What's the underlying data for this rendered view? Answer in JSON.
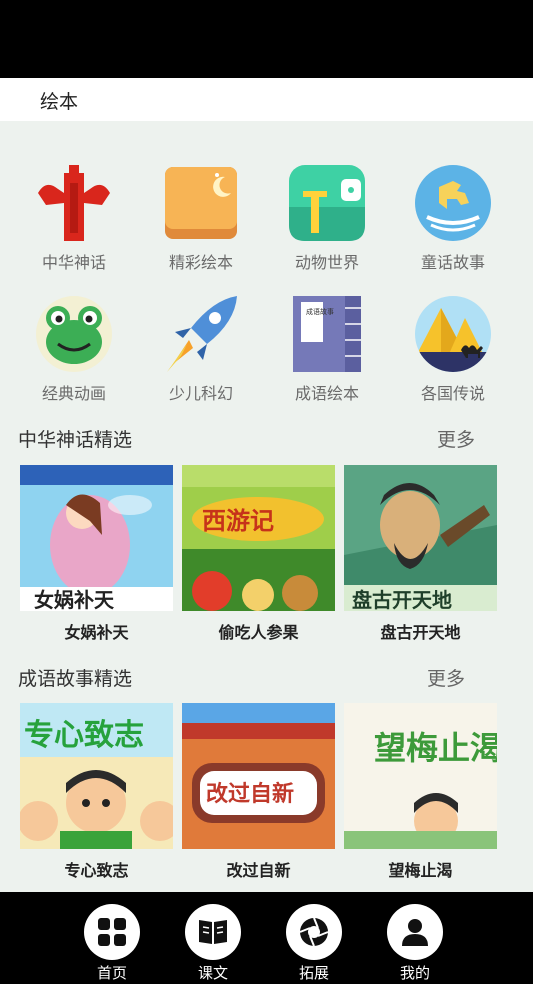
{
  "header": {
    "title": "绘本"
  },
  "categories": [
    {
      "label": "中华神话",
      "icon": "pillar-icon"
    },
    {
      "label": "精彩绘本",
      "icon": "bread-book-icon"
    },
    {
      "label": "动物世界",
      "icon": "giraffe-icon"
    },
    {
      "label": "童话故事",
      "icon": "rocking-horse-icon"
    },
    {
      "label": "经典动画",
      "icon": "frog-icon"
    },
    {
      "label": "少儿科幻",
      "icon": "rocket-icon"
    },
    {
      "label": "成语绘本",
      "icon": "idiom-book-icon"
    },
    {
      "label": "各国传说",
      "icon": "pyramid-camel-icon"
    }
  ],
  "icon_text": {
    "idiom_book": "成语故事"
  },
  "sections": [
    {
      "title": "中华神话精选",
      "more": "更多",
      "books": [
        {
          "title": "女娲补天",
          "cover_text": "女娲补天"
        },
        {
          "title": "偷吃人参果",
          "cover_text": "西游记"
        },
        {
          "title": "盘古开天地",
          "cover_text": "盘古开天地"
        }
      ]
    },
    {
      "title": "成语故事精选",
      "more": "更多",
      "books": [
        {
          "title": "专心致志",
          "cover_text": "专心致志"
        },
        {
          "title": "改过自新",
          "cover_text": "改过自新"
        },
        {
          "title": "望梅止渴",
          "cover_text": "望梅止渴"
        }
      ]
    }
  ],
  "nav": [
    {
      "label": "首页",
      "icon": "grid-icon"
    },
    {
      "label": "课文",
      "icon": "book-icon"
    },
    {
      "label": "拓展",
      "icon": "aperture-icon"
    },
    {
      "label": "我的",
      "icon": "person-icon"
    }
  ],
  "colors": {
    "page_bg": "#edf2ee",
    "bars": "#000000",
    "title_bg": "#ffffff"
  }
}
